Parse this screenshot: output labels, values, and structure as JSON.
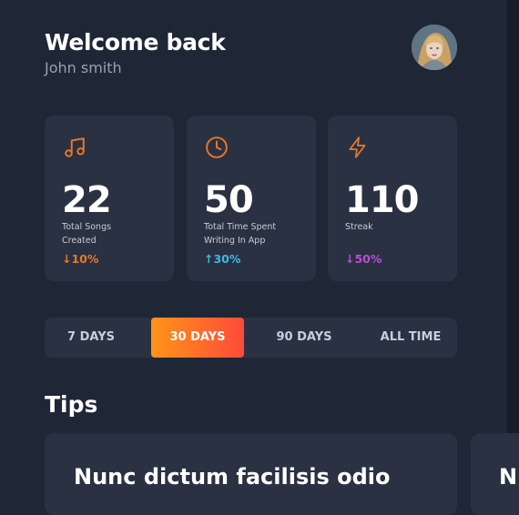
{
  "header": {
    "title": "Welcome back",
    "subtitle": "John smith"
  },
  "stats": [
    {
      "icon": "music-note-icon",
      "value": "22",
      "label": "Total Songs Created",
      "change": "↓10%",
      "color": "#e6792b"
    },
    {
      "icon": "clock-icon",
      "value": "50",
      "label": "Total Time Spent Writing In App",
      "change": "↑30%",
      "color": "#3fb8e6"
    },
    {
      "icon": "lightning-icon",
      "value": "110",
      "label": "Streak",
      "change": "↓50%",
      "color": "#b84ed6"
    }
  ],
  "range_tabs": {
    "items": [
      "7 DAYS",
      "30 DAYS",
      "90 DAYS",
      "ALL TIME"
    ],
    "selected": "30 DAYS"
  },
  "tips": {
    "title": "Tips",
    "items": [
      "Nunc dictum facilisis odio",
      "N"
    ]
  },
  "colors": {
    "background": "#1f2636",
    "card": "#2a3142",
    "accent_gradient": [
      "#ff9418",
      "#ff4a3a"
    ]
  }
}
